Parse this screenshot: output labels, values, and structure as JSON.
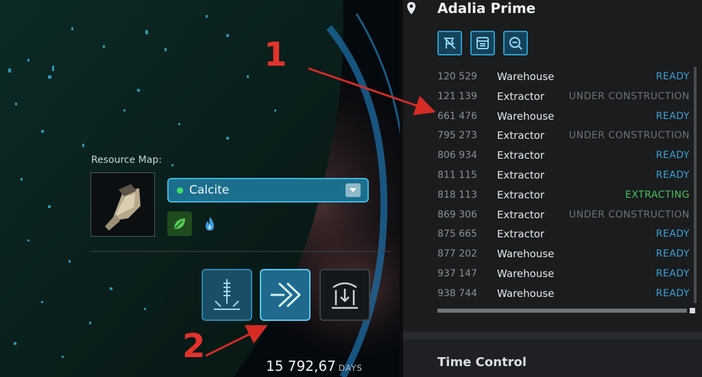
{
  "resource_panel": {
    "label": "Resource Map:",
    "selected_resource": "Calcite",
    "selected_dot_color": "#3fe06a",
    "icons": [
      "leaf-icon",
      "flame-icon"
    ]
  },
  "actions": {
    "buttons": [
      "core-sample-icon",
      "forward-arrow-icon",
      "deposit-icon"
    ]
  },
  "time": {
    "value": "15 792,67",
    "unit": "DAYS"
  },
  "asteroid_panel": {
    "title": "Adalia Prime",
    "tools": [
      "hide-icon",
      "list-icon",
      "zoom-out-icon"
    ],
    "buildings": [
      {
        "id": "120 529",
        "type": "Warehouse",
        "status": "READY"
      },
      {
        "id": "121 139",
        "type": "Extractor",
        "status": "UNDER CONSTRUCTION"
      },
      {
        "id": "661 476",
        "type": "Warehouse",
        "status": "READY"
      },
      {
        "id": "795 273",
        "type": "Extractor",
        "status": "UNDER CONSTRUCTION"
      },
      {
        "id": "806 934",
        "type": "Extractor",
        "status": "READY"
      },
      {
        "id": "811 115",
        "type": "Extractor",
        "status": "READY"
      },
      {
        "id": "818 113",
        "type": "Extractor",
        "status": "EXTRACTING"
      },
      {
        "id": "869 306",
        "type": "Extractor",
        "status": "UNDER CONSTRUCTION"
      },
      {
        "id": "875 665",
        "type": "Extractor",
        "status": "READY"
      },
      {
        "id": "877 202",
        "type": "Warehouse",
        "status": "READY"
      },
      {
        "id": "937 147",
        "type": "Warehouse",
        "status": "READY"
      },
      {
        "id": "938 744",
        "type": "Warehouse",
        "status": "READY"
      }
    ],
    "status_colors": {
      "READY": "#3aa3d6",
      "UNDER CONSTRUCTION": "#6c7478",
      "EXTRACTING": "#49c25a"
    }
  },
  "lower_panel": {
    "title": "Time Control"
  },
  "annotations": {
    "one": "1",
    "two": "2"
  }
}
